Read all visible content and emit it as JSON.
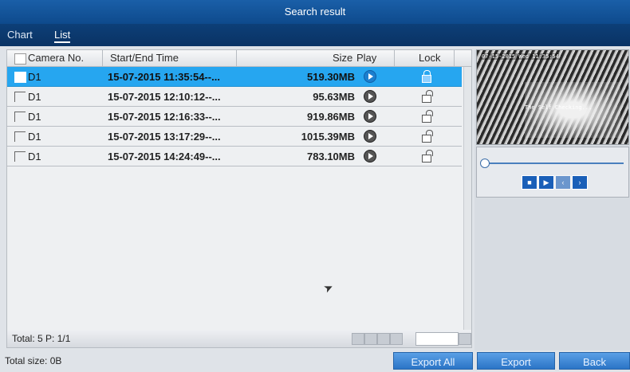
{
  "window": {
    "title": "Search result"
  },
  "tabs": [
    {
      "label": "Chart"
    },
    {
      "label": "List"
    }
  ],
  "table": {
    "headers": {
      "camera": "Camera No.",
      "time": "Start/End Time",
      "size": "Size",
      "play": "Play",
      "lock": "Lock"
    },
    "rows": [
      {
        "camera": "D1",
        "time": "15-07-2015 11:35:54--...",
        "size": "519.30MB",
        "selected": true,
        "locked": true
      },
      {
        "camera": "D1",
        "time": "15-07-2015 12:10:12--...",
        "size": "95.63MB",
        "selected": false,
        "locked": false
      },
      {
        "camera": "D1",
        "time": "15-07-2015 12:16:33--...",
        "size": "919.86MB",
        "selected": false,
        "locked": false
      },
      {
        "camera": "D1",
        "time": "15-07-2015 13:17:29--...",
        "size": "1015.39MB",
        "selected": false,
        "locked": false
      },
      {
        "camera": "D1",
        "time": "15-07-2015 14:24:49--...",
        "size": "783.10MB",
        "selected": false,
        "locked": false
      }
    ]
  },
  "footer": {
    "total": "Total: 5  P: 1/1",
    "total_size": "Total size: 0B"
  },
  "buttons": {
    "export_all": "Export All",
    "export": "Export",
    "back": "Back"
  },
  "preview": {
    "timestamp": "07-15-2015 Wed 11:35:54",
    "overlay": "The Self Checking..."
  },
  "icons": {
    "play": "play-icon",
    "lock": "lock-icon",
    "unlock": "unlock-icon",
    "first": "first-page-icon",
    "prev": "prev-page-icon",
    "next": "next-page-icon",
    "last": "last-page-icon",
    "stop": "stop-icon",
    "fast_forward": "play-icon",
    "step_back": "prev-icon",
    "step_forward": "next-icon"
  },
  "colors": {
    "titlebar": "#1a5fa8",
    "selected_row": "#26a6f0",
    "button": "#2b74c6"
  }
}
